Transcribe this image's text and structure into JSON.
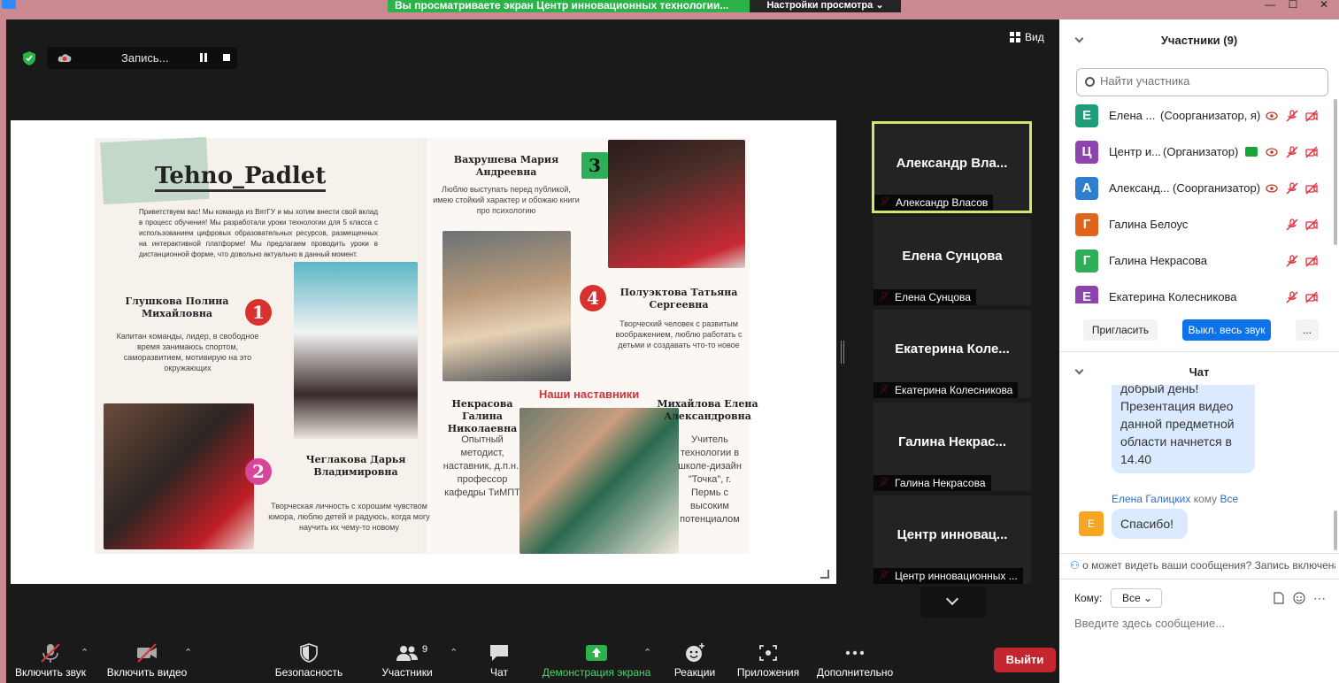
{
  "window": {
    "share_banner": "Вы просматриваете экран Центр инновационных технологии...",
    "view_options": "Настройки просмотра",
    "minimize": "—",
    "maximize": "☐",
    "close": "✕"
  },
  "main": {
    "recording_label": "Запись...",
    "view_label": "Вид"
  },
  "slide": {
    "title": "Tehno_Padlet",
    "intro": "Приветствуем вас! Мы команда из ВятГУ и мы хотим внести свой вклад в процесс обучения! Мы разработали уроки технологии для 5 класса с использованием цифровых образовательных ресурсов, размещенных на интерактивной платформе! Мы предлагаем проводить уроки в дистанционной форме, что довольно актуально в данный момент.",
    "members": [
      {
        "num": "1",
        "name": "Глушкова Полина Михайловна",
        "desc": "Капитан команды, лидер, в свободное время занимаюсь спортом, саморазвитием, мотивирую на это окружающих"
      },
      {
        "num": "2",
        "name": "Чеглакова Дарья Владимировна",
        "desc": "Творческая личность с хорошим чувством юмора, люблю детей и радуюсь, когда могу научить их чему-то новому"
      },
      {
        "num": "3",
        "name": "Вахрушева Мария Андреевна",
        "desc": "Люблю выступать перед публикой, имею стойкий характер и обожаю книги про психологию"
      },
      {
        "num": "4",
        "name": "Полуэктова Татьяна Сергеевна",
        "desc": "Творческий человек с развитым воображением, люблю работать с детьми и создавать что-то новое"
      }
    ],
    "mentors_label": "Наши наставники",
    "mentors": [
      {
        "name": "Некрасова Галина Николаевна",
        "desc": "Опытный методист, наставник, д.п.н., профессор кафедры ТиМПТ"
      },
      {
        "name": "Михайлова Елена Александровна",
        "desc": "Учитель технологии в школе-дизайн \"Точка\", г. Пермь с высоким потенциалом"
      }
    ]
  },
  "tiles": [
    {
      "big": "Александр  Вла...",
      "tag": "Александр Власов",
      "active": true
    },
    {
      "big": "Елена Сунцова",
      "tag": "Елена Сунцова"
    },
    {
      "big": "Екатерина  Коле...",
      "tag": "Екатерина Колесникова"
    },
    {
      "big": "Галина  Некрас...",
      "tag": "Галина Некрасова"
    },
    {
      "big": "Центр  инновац...",
      "tag": "Центр инновационных ..."
    }
  ],
  "toolbar": {
    "audio": "Включить звук",
    "video": "Включить видео",
    "security": "Безопасность",
    "participants": "Участники",
    "participants_count": "9",
    "chat": "Чат",
    "share": "Демонстрация экрана",
    "reactions": "Реакции",
    "apps": "Приложения",
    "more": "Дополнительно",
    "leave": "Выйти"
  },
  "panel": {
    "participants_header": "Участники (9)",
    "search_placeholder": "Найти участника",
    "participants": [
      {
        "initial": "Е",
        "color": "#1f9d7a",
        "name": "Елена ...",
        "role": "(Соорганизатор, я)"
      },
      {
        "initial": "Ц",
        "color": "#8e44ad",
        "name": "Центр и...",
        "role": "(Организатор)"
      },
      {
        "initial": "А",
        "color": "#2f7fd1",
        "name": "Александ...",
        "role": "(Соорганизатор)"
      },
      {
        "initial": "Г",
        "color": "#e0651b",
        "name": "Галина Белоус",
        "role": ""
      },
      {
        "initial": "Г",
        "color": "#2fae5a",
        "name": "Галина Некрасова",
        "role": ""
      },
      {
        "initial": "Е",
        "color": "#8e44ad",
        "name": "Екатерина Колесникова",
        "role": ""
      }
    ],
    "invite": "Пригласить",
    "mute_all": "Выкл. весь звук",
    "more": "...",
    "chat_header": "Чат",
    "messages": [
      {
        "text_lines": [
          "добрый день!",
          "Презентация видео",
          "данной предметной",
          "области начнется в",
          "14.40"
        ]
      }
    ],
    "msg2_from": "Елена Галицких",
    "msg2_to_word": "кому",
    "msg2_to": "Все",
    "msg2_initial": "Е",
    "msg2_text": "Спасибо!",
    "notice": "о может видеть ваши сообщения? Запись включена",
    "to_label": "Кому:",
    "to_value": "Все",
    "compose_placeholder": "Введите здесь сообщение..."
  },
  "colors": {
    "active_tile_border": "#d7e36a",
    "share_green": "#2bb34a",
    "leave_red": "#c3262f",
    "mute_red": "#e0303a",
    "mute_all_blue": "#0e72ed"
  }
}
